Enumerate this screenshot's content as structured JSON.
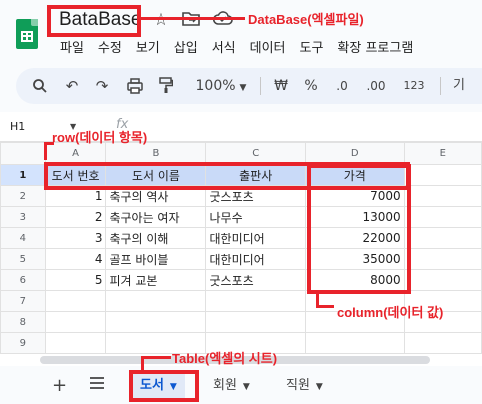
{
  "app": {
    "doc_title": "BataBase",
    "menu": [
      "파일",
      "수정",
      "보기",
      "삽입",
      "서식",
      "데이터",
      "도구",
      "확장 프로그램"
    ]
  },
  "toolbar": {
    "zoom": "100%",
    "currency": "₩",
    "percent": "%",
    "dec_less": ".0",
    "dec_more": ".00",
    "format_123": "123",
    "font_hint": "기"
  },
  "formula_bar": {
    "cell_ref": "H1",
    "fx": "fx"
  },
  "sheet": {
    "columns": [
      "A",
      "B",
      "C",
      "D",
      "E"
    ],
    "row_numbers": [
      "1",
      "2",
      "3",
      "4",
      "5",
      "6",
      "7",
      "8",
      "9"
    ],
    "headers": [
      "도서 번호",
      "도서 이름",
      "출판사",
      "가격"
    ],
    "rows": [
      [
        "1",
        "축구의 역사",
        "굿스포츠",
        "7000"
      ],
      [
        "2",
        "축구아는 여자",
        "나무수",
        "13000"
      ],
      [
        "3",
        "축구의 이해",
        "대한미디어",
        "22000"
      ],
      [
        "4",
        "골프 바이블",
        "대한미디어",
        "35000"
      ],
      [
        "5",
        "피겨 교본",
        "굿스포츠",
        "8000"
      ]
    ]
  },
  "tabs": {
    "items": [
      "도서",
      "회원",
      "직원"
    ],
    "active_index": 0
  },
  "annotations": {
    "database": "DataBase(엑셀파일)",
    "row": "row(데이터 항목)",
    "column": "column(데이터 값)",
    "table": "Table(엑셀의 시트)"
  },
  "colors": {
    "annotation": "#e8232b",
    "header_fill": "#c9daf8",
    "active_tab": "#0b57d0"
  }
}
